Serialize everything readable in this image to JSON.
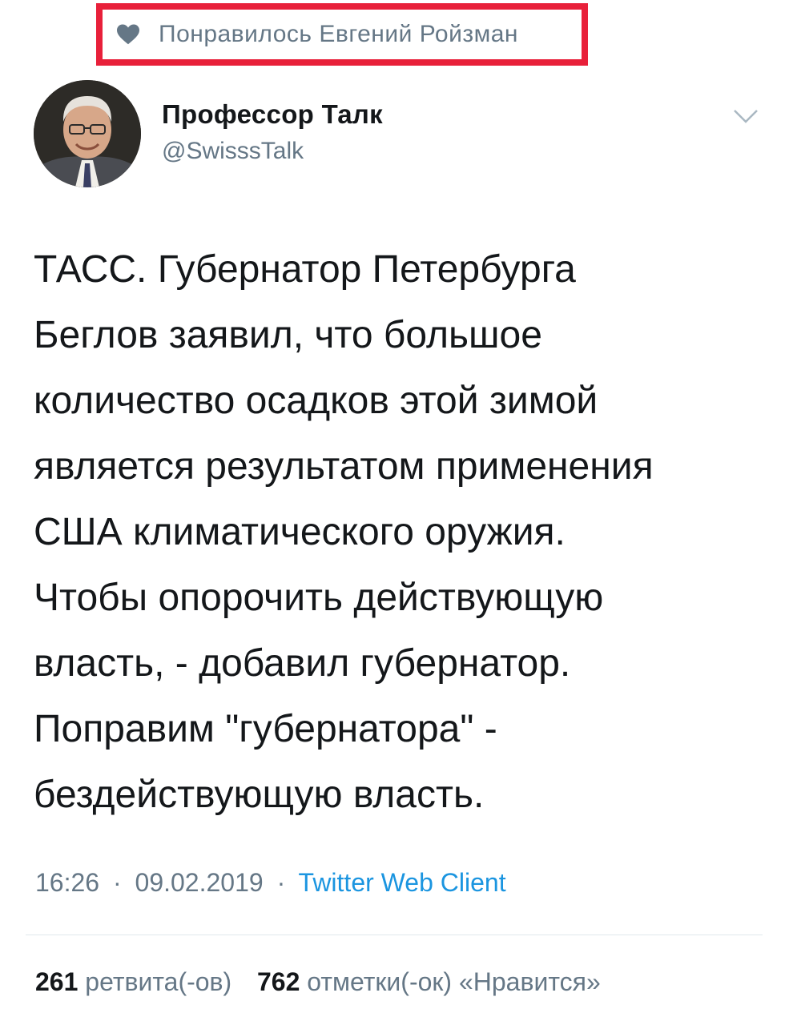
{
  "liked_banner": {
    "icon": "heart-icon",
    "text": "Понравилось Евгений Ройзман",
    "highlight_color": "#e8203a"
  },
  "author": {
    "name": "Профессор Талк",
    "handle": "@SwisssTalk",
    "avatar": "avatar-photo"
  },
  "menu_icon": "chevron-down-icon",
  "tweet": {
    "text": "ТАСС. Губернатор Петербурга\nБеглов заявил, что большое\nколичество осадков этой зимой\nявляется результатом применения\nСША климатического оружия.\nЧтобы опорочить действующую\nвласть, - добавил губернатор.\nПоправим \"губернатора\" -\nбездействующую власть."
  },
  "meta": {
    "time": "16:26",
    "separator": "·",
    "date": "09.02.2019",
    "client": "Twitter Web Client"
  },
  "stats": {
    "retweets_count": "261",
    "retweets_label": "ретвита(-ов)",
    "likes_count": "762",
    "likes_label": "отметки(-ок) «Нравится»"
  },
  "colors": {
    "text": "#14171a",
    "secondary": "#657786",
    "link": "#1b95e0",
    "divider": "#e1e8ed"
  }
}
